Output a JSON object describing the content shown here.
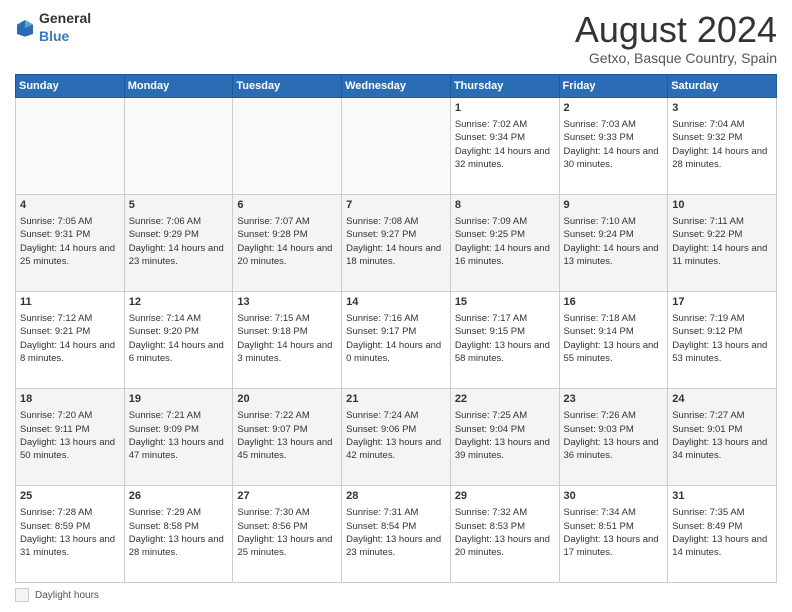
{
  "header": {
    "logo_general": "General",
    "logo_blue": "Blue",
    "title": "August 2024",
    "subtitle": "Getxo, Basque Country, Spain"
  },
  "days_of_week": [
    "Sunday",
    "Monday",
    "Tuesday",
    "Wednesday",
    "Thursday",
    "Friday",
    "Saturday"
  ],
  "weeks": [
    [
      {
        "day": "",
        "content": ""
      },
      {
        "day": "",
        "content": ""
      },
      {
        "day": "",
        "content": ""
      },
      {
        "day": "",
        "content": ""
      },
      {
        "day": "1",
        "content": "Sunrise: 7:02 AM\nSunset: 9:34 PM\nDaylight: 14 hours and 32 minutes."
      },
      {
        "day": "2",
        "content": "Sunrise: 7:03 AM\nSunset: 9:33 PM\nDaylight: 14 hours and 30 minutes."
      },
      {
        "day": "3",
        "content": "Sunrise: 7:04 AM\nSunset: 9:32 PM\nDaylight: 14 hours and 28 minutes."
      }
    ],
    [
      {
        "day": "4",
        "content": "Sunrise: 7:05 AM\nSunset: 9:31 PM\nDaylight: 14 hours and 25 minutes."
      },
      {
        "day": "5",
        "content": "Sunrise: 7:06 AM\nSunset: 9:29 PM\nDaylight: 14 hours and 23 minutes."
      },
      {
        "day": "6",
        "content": "Sunrise: 7:07 AM\nSunset: 9:28 PM\nDaylight: 14 hours and 20 minutes."
      },
      {
        "day": "7",
        "content": "Sunrise: 7:08 AM\nSunset: 9:27 PM\nDaylight: 14 hours and 18 minutes."
      },
      {
        "day": "8",
        "content": "Sunrise: 7:09 AM\nSunset: 9:25 PM\nDaylight: 14 hours and 16 minutes."
      },
      {
        "day": "9",
        "content": "Sunrise: 7:10 AM\nSunset: 9:24 PM\nDaylight: 14 hours and 13 minutes."
      },
      {
        "day": "10",
        "content": "Sunrise: 7:11 AM\nSunset: 9:22 PM\nDaylight: 14 hours and 11 minutes."
      }
    ],
    [
      {
        "day": "11",
        "content": "Sunrise: 7:12 AM\nSunset: 9:21 PM\nDaylight: 14 hours and 8 minutes."
      },
      {
        "day": "12",
        "content": "Sunrise: 7:14 AM\nSunset: 9:20 PM\nDaylight: 14 hours and 6 minutes."
      },
      {
        "day": "13",
        "content": "Sunrise: 7:15 AM\nSunset: 9:18 PM\nDaylight: 14 hours and 3 minutes."
      },
      {
        "day": "14",
        "content": "Sunrise: 7:16 AM\nSunset: 9:17 PM\nDaylight: 14 hours and 0 minutes."
      },
      {
        "day": "15",
        "content": "Sunrise: 7:17 AM\nSunset: 9:15 PM\nDaylight: 13 hours and 58 minutes."
      },
      {
        "day": "16",
        "content": "Sunrise: 7:18 AM\nSunset: 9:14 PM\nDaylight: 13 hours and 55 minutes."
      },
      {
        "day": "17",
        "content": "Sunrise: 7:19 AM\nSunset: 9:12 PM\nDaylight: 13 hours and 53 minutes."
      }
    ],
    [
      {
        "day": "18",
        "content": "Sunrise: 7:20 AM\nSunset: 9:11 PM\nDaylight: 13 hours and 50 minutes."
      },
      {
        "day": "19",
        "content": "Sunrise: 7:21 AM\nSunset: 9:09 PM\nDaylight: 13 hours and 47 minutes."
      },
      {
        "day": "20",
        "content": "Sunrise: 7:22 AM\nSunset: 9:07 PM\nDaylight: 13 hours and 45 minutes."
      },
      {
        "day": "21",
        "content": "Sunrise: 7:24 AM\nSunset: 9:06 PM\nDaylight: 13 hours and 42 minutes."
      },
      {
        "day": "22",
        "content": "Sunrise: 7:25 AM\nSunset: 9:04 PM\nDaylight: 13 hours and 39 minutes."
      },
      {
        "day": "23",
        "content": "Sunrise: 7:26 AM\nSunset: 9:03 PM\nDaylight: 13 hours and 36 minutes."
      },
      {
        "day": "24",
        "content": "Sunrise: 7:27 AM\nSunset: 9:01 PM\nDaylight: 13 hours and 34 minutes."
      }
    ],
    [
      {
        "day": "25",
        "content": "Sunrise: 7:28 AM\nSunset: 8:59 PM\nDaylight: 13 hours and 31 minutes."
      },
      {
        "day": "26",
        "content": "Sunrise: 7:29 AM\nSunset: 8:58 PM\nDaylight: 13 hours and 28 minutes."
      },
      {
        "day": "27",
        "content": "Sunrise: 7:30 AM\nSunset: 8:56 PM\nDaylight: 13 hours and 25 minutes."
      },
      {
        "day": "28",
        "content": "Sunrise: 7:31 AM\nSunset: 8:54 PM\nDaylight: 13 hours and 23 minutes."
      },
      {
        "day": "29",
        "content": "Sunrise: 7:32 AM\nSunset: 8:53 PM\nDaylight: 13 hours and 20 minutes."
      },
      {
        "day": "30",
        "content": "Sunrise: 7:34 AM\nSunset: 8:51 PM\nDaylight: 13 hours and 17 minutes."
      },
      {
        "day": "31",
        "content": "Sunrise: 7:35 AM\nSunset: 8:49 PM\nDaylight: 13 hours and 14 minutes."
      }
    ]
  ],
  "footer": {
    "daylight_label": "Daylight hours"
  }
}
